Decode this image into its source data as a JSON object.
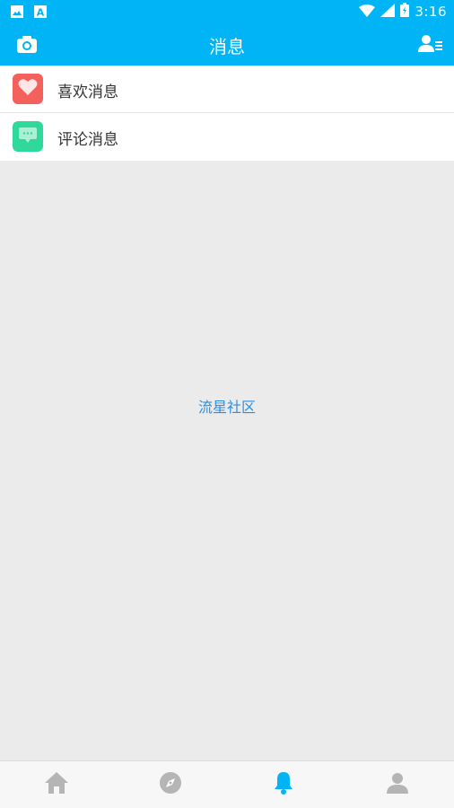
{
  "status_bar": {
    "time": "3:16",
    "left_icons": [
      "image-icon",
      "a-badge-icon"
    ],
    "right_icons": [
      "wifi-icon",
      "signal-icon",
      "battery-icon"
    ]
  },
  "header": {
    "title": "消息",
    "left_icon": "camera-icon",
    "right_icon": "contacts-icon",
    "background": "#00b4f5"
  },
  "messages": {
    "items": [
      {
        "label": "喜欢消息",
        "icon": "heart-icon",
        "icon_color": "#f4605b"
      },
      {
        "label": "评论消息",
        "icon": "comment-icon",
        "icon_color": "#2fd89b"
      }
    ]
  },
  "content": {
    "center_text": "流星社区",
    "text_color": "#2b8fe0"
  },
  "bottom_nav": {
    "items": [
      {
        "icon": "home-icon",
        "active": false
      },
      {
        "icon": "compass-icon",
        "active": false
      },
      {
        "icon": "bell-icon",
        "active": true
      },
      {
        "icon": "person-icon",
        "active": false
      }
    ],
    "active_color": "#00b4f5",
    "inactive_color": "#b5b5b5"
  }
}
